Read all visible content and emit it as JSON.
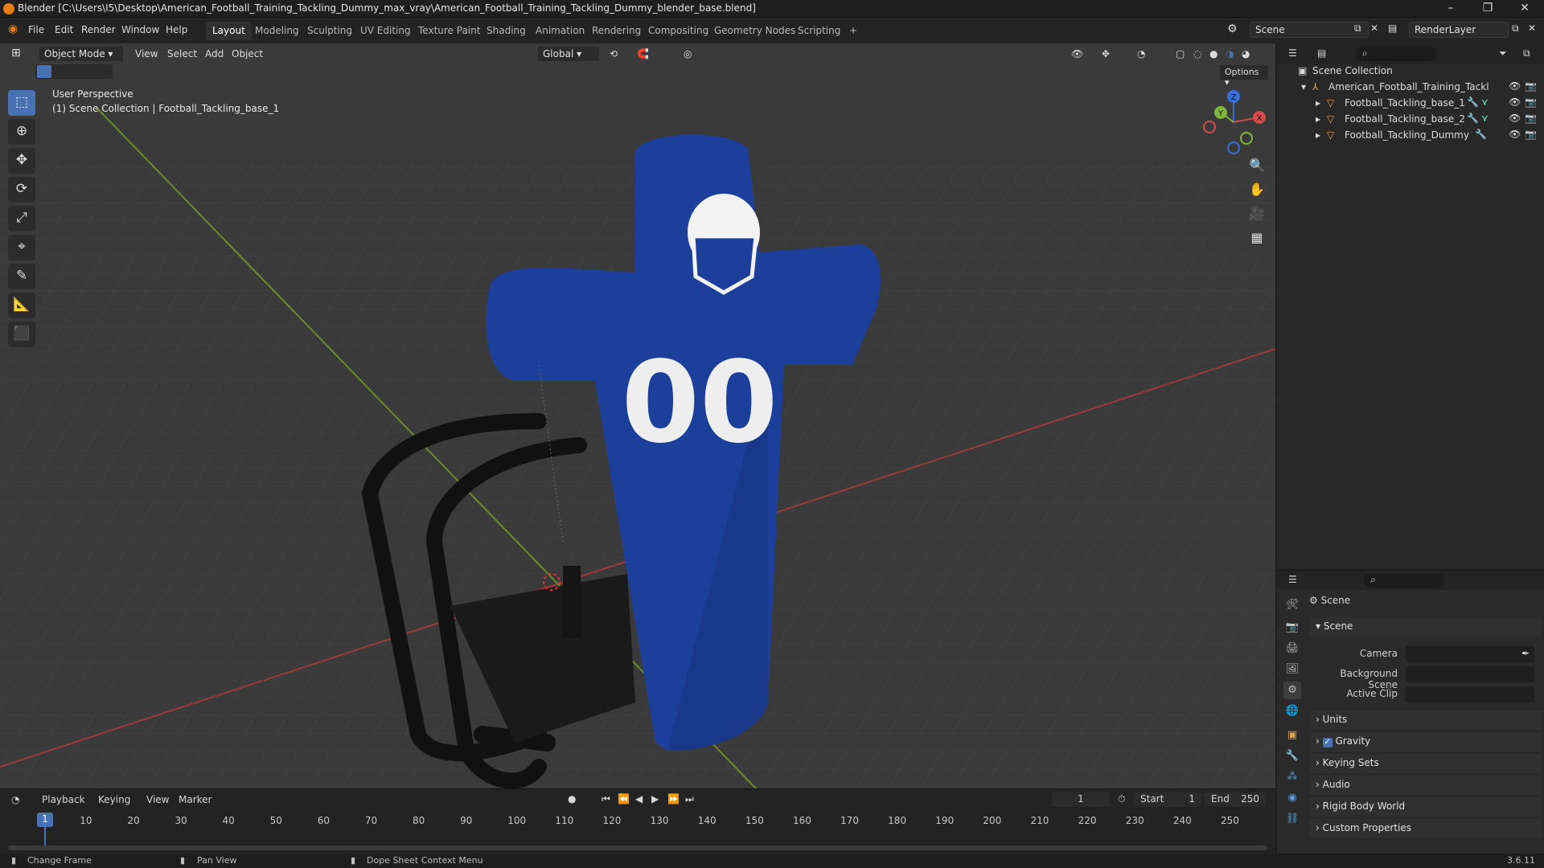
{
  "window": {
    "title": "Blender [C:\\Users\\I5\\Desktop\\American_Football_Training_Tackling_Dummy_max_vray\\American_Football_Training_Tackling_Dummy_blender_base.blend]"
  },
  "menu": {
    "items": [
      "File",
      "Edit",
      "Render",
      "Window",
      "Help"
    ]
  },
  "workspaces": [
    "Layout",
    "Modeling",
    "Sculpting",
    "UV Editing",
    "Texture Paint",
    "Shading",
    "Animation",
    "Rendering",
    "Compositing",
    "Geometry Nodes",
    "Scripting",
    "+"
  ],
  "topright": {
    "scene": "Scene",
    "render_layer": "RenderLayer"
  },
  "viewport_header": {
    "mode": "Object Mode",
    "menus": [
      "View",
      "Select",
      "Add",
      "Object"
    ],
    "transform": "Global",
    "options": "Options"
  },
  "viewport": {
    "perspective": "User Perspective",
    "context": "(1) Scene Collection | Football_Tackling_base_1",
    "jersey_number": "00"
  },
  "gizmo": {
    "z": "Z",
    "y": "Y",
    "x": "X"
  },
  "outliner": {
    "root": "Scene Collection",
    "items": [
      {
        "name": "American_Football_Training_Tackling_D",
        "level": 1
      },
      {
        "name": "Football_Tackling_base_1",
        "level": 2
      },
      {
        "name": "Football_Tackling_base_2",
        "level": 2
      },
      {
        "name": "Football_Tackling_Dummy",
        "level": 2
      }
    ]
  },
  "properties": {
    "context": "Scene",
    "section": "Scene",
    "fields": [
      {
        "label": "Camera"
      },
      {
        "label": "Background Scene"
      },
      {
        "label": "Active Clip"
      }
    ],
    "collapsed": [
      "Units",
      "Gravity",
      "Keying Sets",
      "Audio",
      "Rigid Body World",
      "Custom Properties"
    ],
    "gravity_checked": true
  },
  "timeline": {
    "menus": [
      "Playback",
      "Keying",
      "View",
      "Marker"
    ],
    "current_frame": "1",
    "start_label": "Start",
    "start": "1",
    "end_label": "End",
    "end": "250",
    "ticks": [
      "1",
      "10",
      "20",
      "30",
      "40",
      "50",
      "60",
      "70",
      "80",
      "90",
      "100",
      "110",
      "120",
      "130",
      "140",
      "150",
      "160",
      "170",
      "180",
      "190",
      "200",
      "210",
      "220",
      "230",
      "240",
      "250"
    ]
  },
  "status": {
    "items": [
      "Change Frame",
      "Pan View",
      "Dope Sheet Context Menu"
    ],
    "version": "3.6.11"
  },
  "colors": {
    "accent": "#4772b3",
    "dummy_blue": "#1d3f9c",
    "grid_red": "#9b3a3a",
    "grid_green": "#6b8a2a"
  }
}
